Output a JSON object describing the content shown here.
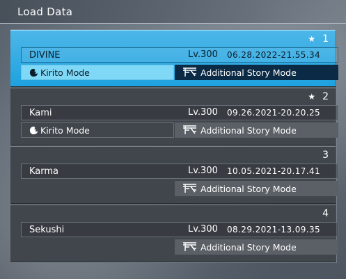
{
  "header": {
    "title": "Load Data"
  },
  "slots": [
    {
      "num": "1",
      "star": "★",
      "name": "DIVINE",
      "lv": "Lv.300",
      "date": "06.28.2022-21.55.34",
      "kirito": "Kirito Mode",
      "story": "Additional Story Mode"
    },
    {
      "num": "2",
      "star": "★",
      "name": "Kami",
      "lv": "Lv.300",
      "date": "09.26.2021-20.20.25",
      "kirito": "Kirito Mode",
      "story": "Additional Story Mode"
    },
    {
      "num": "3",
      "star": "",
      "name": "Karma",
      "lv": "Lv.300",
      "date": "10.05.2021-20.17.41",
      "kirito": "",
      "story": "Additional Story Mode"
    },
    {
      "num": "4",
      "star": "",
      "name": "Sekushi",
      "lv": "Lv.300",
      "date": "08.29.2021-13.09.35",
      "kirito": "",
      "story": "Additional Story Mode"
    }
  ],
  "colors": {
    "selected": "#1ea2df",
    "panel": "#41464c",
    "story_selected": "#0b2a45"
  }
}
